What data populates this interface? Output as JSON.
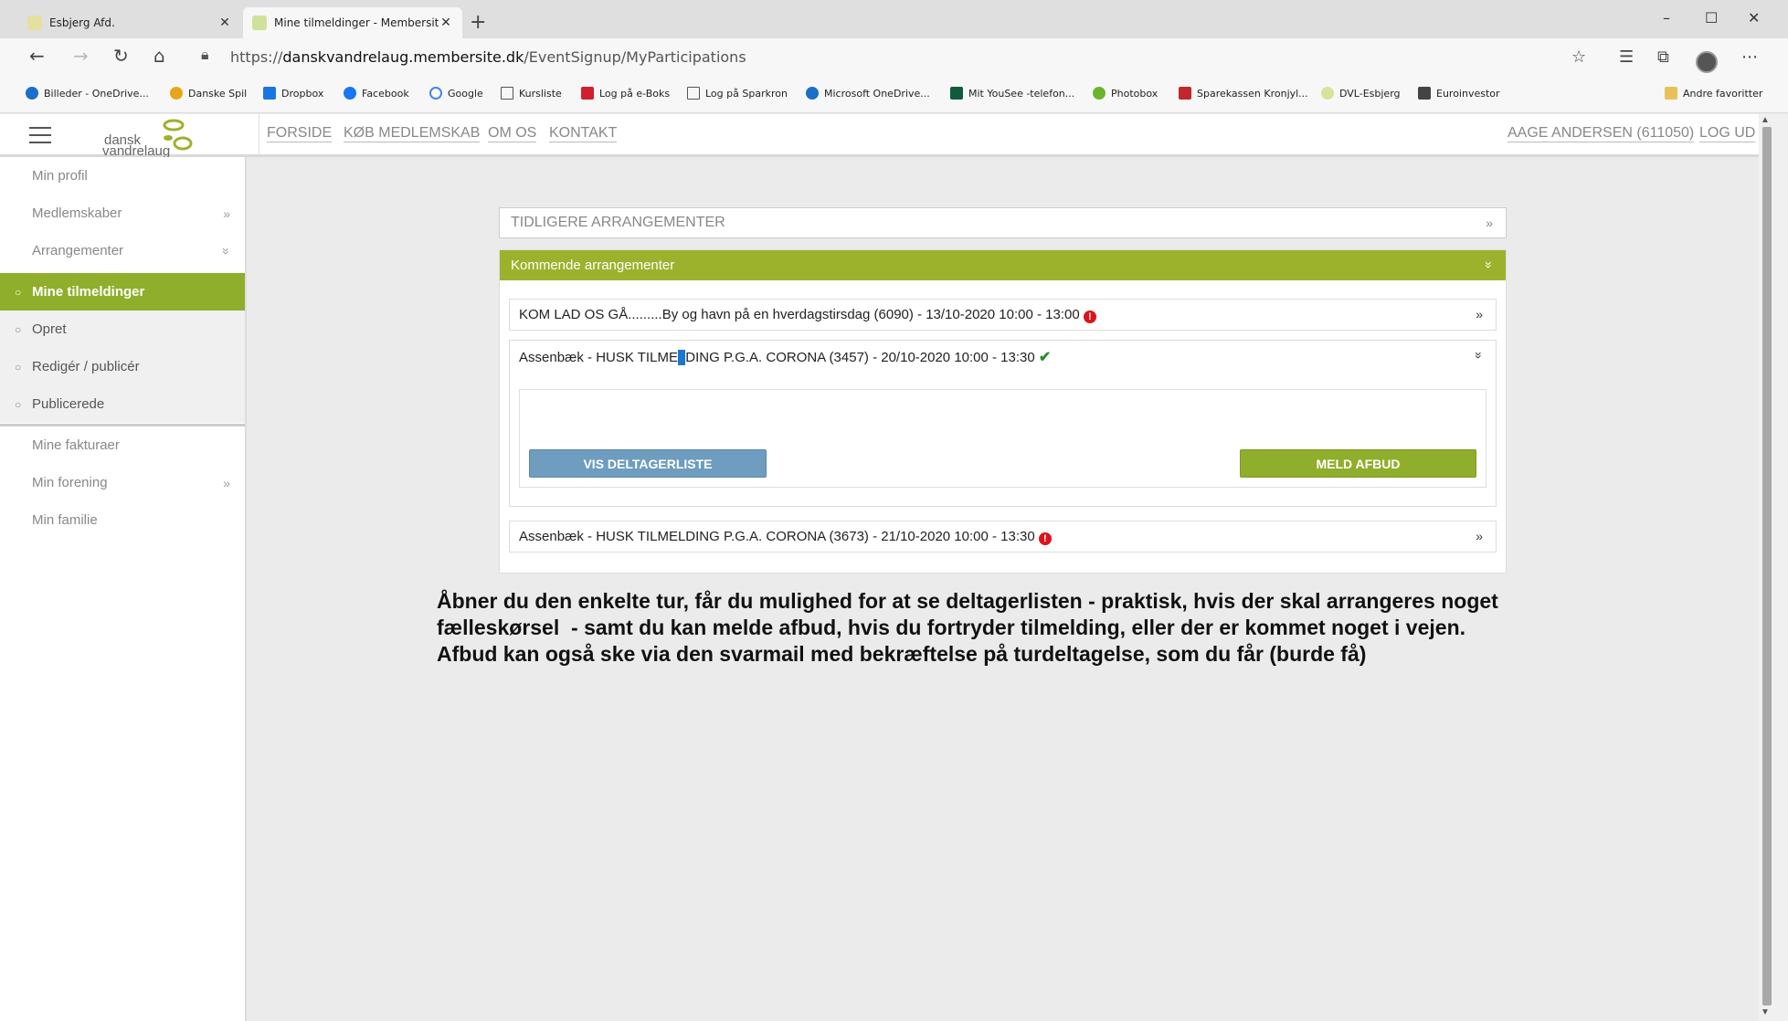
{
  "browser": {
    "tabs": [
      {
        "title": "Esbjerg Afd."
      },
      {
        "title": "Mine tilmeldinger - Membersite"
      }
    ],
    "url_prefix": "https://",
    "url_domain": "danskvandrelaug.membersite.dk",
    "url_path": "/EventSignup/MyParticipations",
    "bookmarks": [
      "Billeder - OneDrive...",
      "Danske Spil",
      "Dropbox",
      "Facebook",
      "Google",
      "Kursliste",
      "Log på e-Boks",
      "Log på Sparkron",
      "Microsoft OneDrive...",
      "Mit YouSee -telefon...",
      "Photobox",
      "Sparekassen Kronjyl...",
      "DVL-Esbjerg",
      "Euroinvestor",
      "Andre favoritter"
    ]
  },
  "logo": {
    "line1": "dansk",
    "line2": "vandrelaug"
  },
  "topnav": {
    "items": [
      "FORSIDE",
      "KØB MEDLEMSKAB",
      "OM OS",
      "KONTAKT"
    ],
    "user": "AAGE ANDERSEN (611050)",
    "logout": "LOG UD"
  },
  "sidebar": {
    "items": [
      {
        "label": "Min profil"
      },
      {
        "label": "Medlemskaber",
        "chevron": "»"
      },
      {
        "label": "Arrangementer",
        "chevron": "»"
      }
    ],
    "subitems": [
      "Mine tilmeldinger",
      "Opret",
      "Redigér / publicér",
      "Publicerede"
    ],
    "items_after": [
      {
        "label": "Mine fakturaer"
      },
      {
        "label": "Min forening",
        "chevron": "»"
      },
      {
        "label": "Min familie"
      }
    ]
  },
  "main": {
    "previous_header": "TIDLIGERE ARRANGEMENTER",
    "upcoming_header": "Kommende arrangementer",
    "events": [
      {
        "text": "KOM LAD OS GÅ.........By og havn på en hverdagstirsdag (6090) - 13/10-2020 10:00 - 13:00",
        "status": "warning"
      },
      {
        "text_before": "Assenbæk - HUSK TILME",
        "text_cursor": "L",
        "text_after": "DING P.G.A. CORONA (3457) - 20/10-2020 10:00 - 13:30",
        "status": "ok"
      },
      {
        "text": "Assenbæk - HUSK TILMELDING P.G.A. CORONA (3673) - 21/10-2020 10:00 - 13:30",
        "status": "warning"
      }
    ],
    "btn_participants": "VIS DELTAGERLISTE",
    "btn_cancel": "MELD AFBUD"
  },
  "note": {
    "line1": "Åbner du den enkelte tur, får du mulighed for at se deltagerlisten - praktisk, hvis der skal arrangeres noget",
    "line2": "fælleskørsel  - samt du kan melde afbud, hvis du fortryder tilmelding, eller der er kommet noget i vejen.",
    "line3": "Afbud kan også ske via den svarmail med bekræftelse på turdeltagelse, som du får (burde få)"
  },
  "colors": {
    "accent_green": "#8fae2b",
    "button_blue": "#6e9dbf",
    "warning_red": "#d9141a",
    "ok_green": "#2e8b2e"
  }
}
